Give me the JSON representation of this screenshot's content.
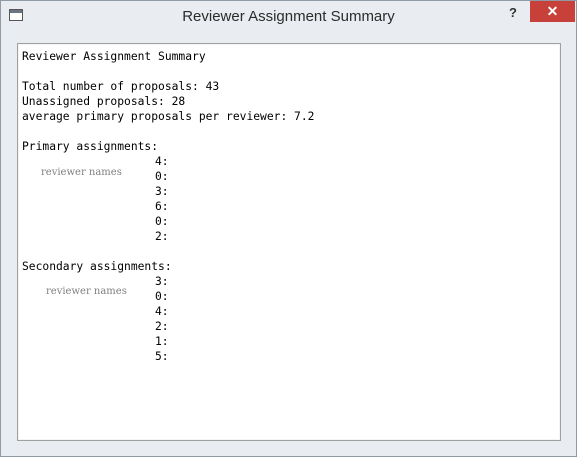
{
  "window": {
    "title": "Reviewer Assignment Summary",
    "help_glyph": "?",
    "close_glyph": "✕"
  },
  "content": {
    "heading": "Reviewer Assignment Summary",
    "total_line": "Total number of proposals: 43",
    "unassigned_line": "Unassigned proposals: 28",
    "average_line": "average primary proposals per reviewer: 7.2",
    "primary": {
      "label": "Primary assignments:",
      "names_placeholder": "reviewer names",
      "counts": [
        "4:",
        "0:",
        "3:",
        "6:",
        "0:",
        "2:"
      ]
    },
    "secondary": {
      "label": "Secondary assignments:",
      "names_placeholder": "reviewer names",
      "counts": [
        "3:",
        "0:",
        "4:",
        "2:",
        "1:",
        "5:"
      ]
    }
  },
  "colors": {
    "close_button": "#c8403a",
    "window_chrome": "#e9edf1"
  }
}
